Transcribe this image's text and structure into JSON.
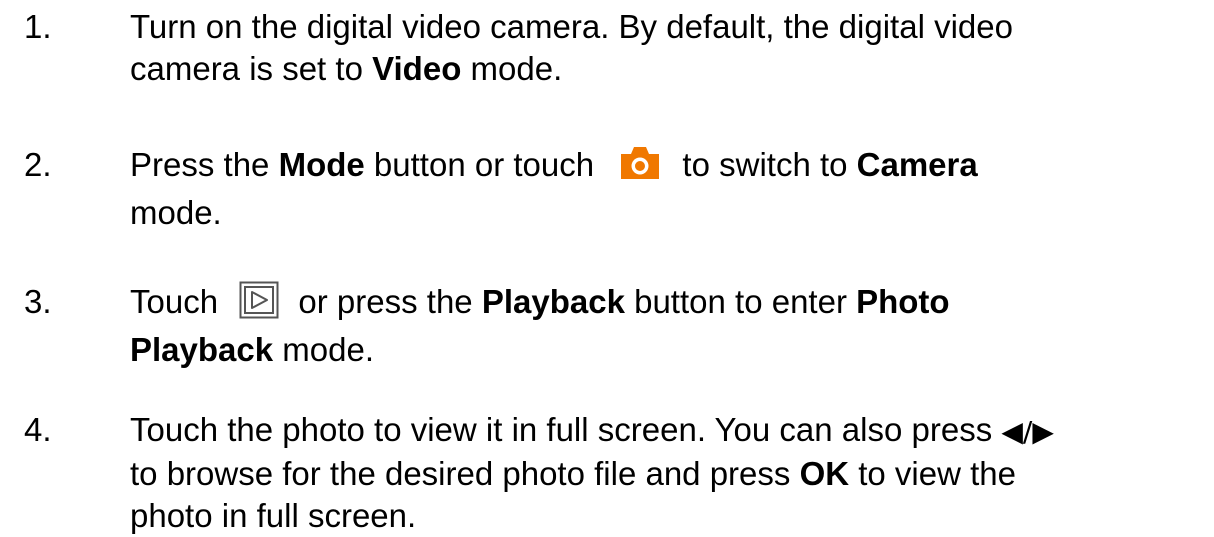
{
  "steps": [
    {
      "number": "1.",
      "line1": "Turn on the digital video camera. By default, the digital video",
      "line2_a": "camera is set to ",
      "line2_b": "Video",
      "line2_c": " mode."
    },
    {
      "number": "2.",
      "a": "Press the ",
      "b": "Mode",
      "c": " button or touch ",
      "icon": "camera-mode-icon",
      "d": " to switch to ",
      "e": "Camera",
      "line2": "mode."
    },
    {
      "number": "3.",
      "a": "Touch ",
      "icon": "playback-icon",
      "b": " or press the ",
      "c": "Playback",
      "d": " button to enter ",
      "e": "Photo",
      "line2_a": "Playback",
      "line2_b": " mode."
    },
    {
      "number": "4.",
      "line1_a": "Touch the photo to view it in full screen. You can also press ",
      "line1_b": "◀/▶",
      "line2_a": "to browse for the desired photo file and press ",
      "line2_b": "OK",
      "line2_c": " to view the",
      "line3": "photo in full screen."
    }
  ],
  "colors": {
    "camera_icon": "#f07800",
    "text": "#000000"
  }
}
